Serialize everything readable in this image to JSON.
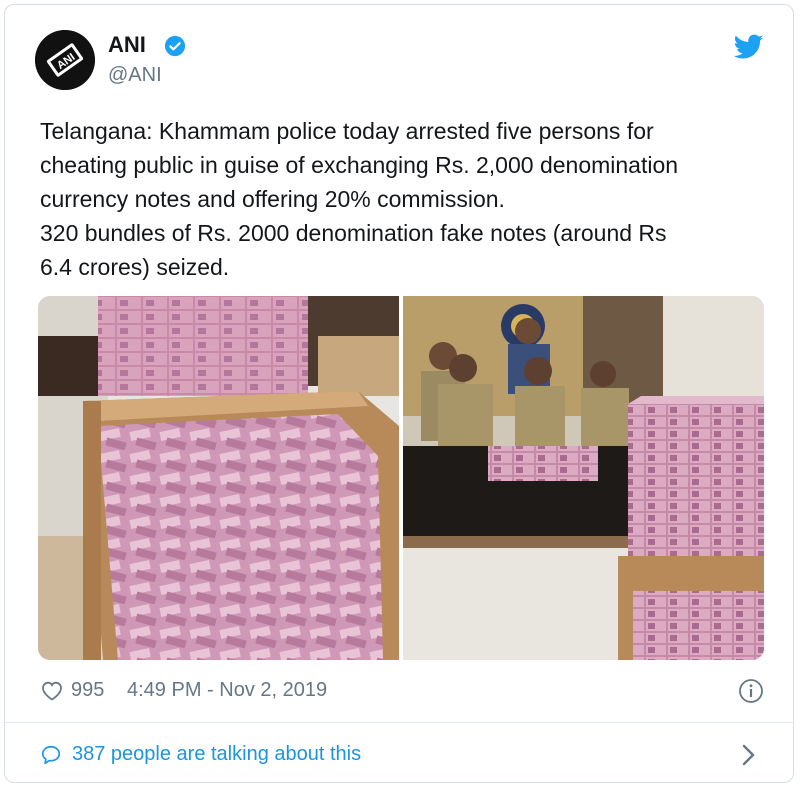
{
  "account": {
    "name": "ANI",
    "handle": "@ANI",
    "avatar_text": "ANI"
  },
  "tweet": {
    "lines": [
      "Telangana: Khammam police today arrested five persons for",
      "cheating public in guise of exchanging Rs. 2,000 denomination",
      "currency notes and offering 20% commission.",
      "320 bundles of Rs. 2000 denomination fake notes (around Rs",
      "6.4 crores) seized."
    ]
  },
  "footer": {
    "likes": "995",
    "timestamp": "4:49 PM - Nov 2, 2019",
    "talking": "387 people are talking about this"
  },
  "colors": {
    "link": "#1b95e0",
    "muted": "#657786",
    "twitter_blue": "#1da1f2"
  },
  "icons": [
    "verified-badge-icon",
    "twitter-bird-icon",
    "heart-icon",
    "info-icon",
    "comment-bubble-icon",
    "chevron-right-icon"
  ]
}
